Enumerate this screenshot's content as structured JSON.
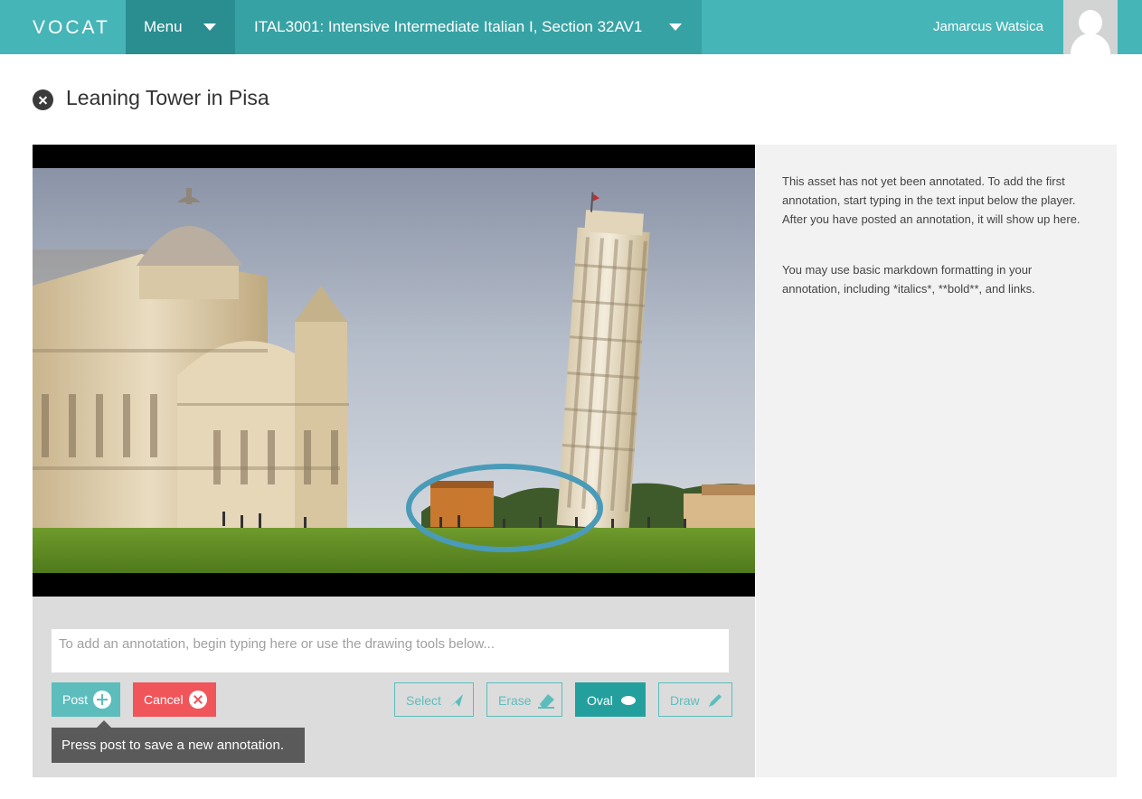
{
  "header": {
    "logo_text": "VOCAT",
    "menu_label": "Menu",
    "course_label": "ITAL3001: Intensive Intermediate Italian I, Section 32AV1",
    "user_name": "Jamarcus Watsica",
    "colors": {
      "bar": "#46b5b7",
      "menu": "#2a8d8f",
      "course": "#37a2a4"
    }
  },
  "page": {
    "title": "Leaning Tower in Pisa",
    "close_icon": "close-icon"
  },
  "player": {
    "image_subject": "Pisa cathedral and leaning tower photo",
    "annotation_shape": "oval",
    "annotation_color": "#4a9bb8"
  },
  "annotator": {
    "input_placeholder": "To add an annotation, begin typing here or use the drawing tools below...",
    "post_label": "Post",
    "cancel_label": "Cancel",
    "tools": {
      "select_label": "Select",
      "erase_label": "Erase",
      "oval_label": "Oval",
      "draw_label": "Draw",
      "active_tool": "Oval"
    },
    "tooltip": "Press post to save a new annotation."
  },
  "sidebar": {
    "paragraph_1": "This asset has not yet been annotated. To add the first annotation, start typing in the text input below the player. After you have posted an annotation, it will show up here.",
    "paragraph_2": "You may use basic markdown formatting in your annotation, including *italics*, **bold**, and links."
  }
}
